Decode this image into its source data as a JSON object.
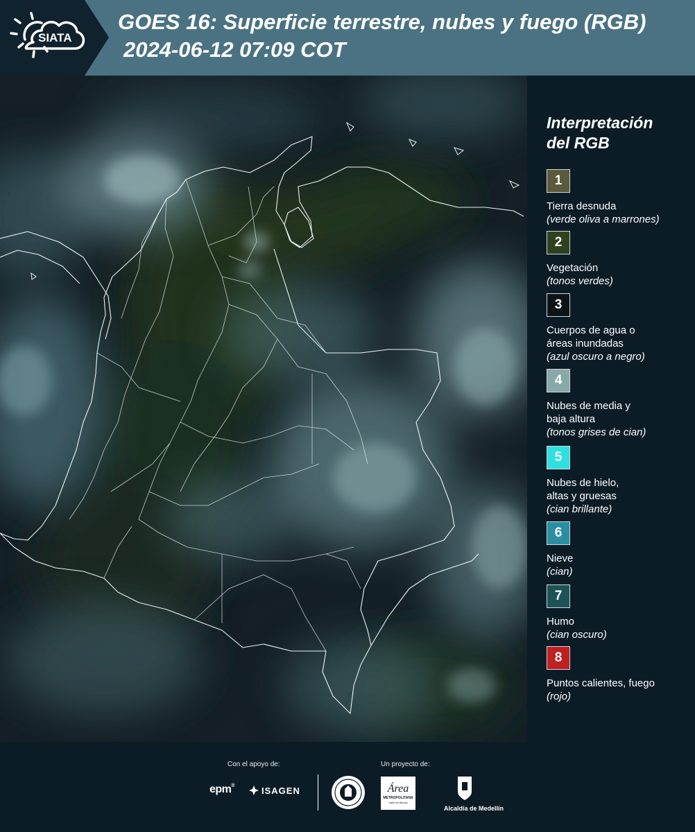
{
  "header": {
    "logo_text": "SIATA",
    "title": "GOES 16: Superficie terrestre, nubes y fuego (RGB)",
    "datetime": "2024-06-12 07:09 COT"
  },
  "legend": {
    "title_line1": "Interpretación",
    "title_line2": "del RGB",
    "items": [
      {
        "num": "1",
        "color": "#5b5a3c",
        "label_lines": [
          "Tierra desnuda"
        ],
        "note": "(verde oliva a marrones)"
      },
      {
        "num": "2",
        "color": "#2f4220",
        "label_lines": [
          "Vegetación"
        ],
        "note": "(tonos verdes)"
      },
      {
        "num": "3",
        "color": "#0d1418",
        "label_lines": [
          "Cuerpos de agua o",
          "áreas inundadas"
        ],
        "note": "(azul oscuro a negro)"
      },
      {
        "num": "4",
        "color": "#88a9a9",
        "label_lines": [
          "Nubes de media y",
          "baja altura"
        ],
        "note": "(tonos grises de cian)"
      },
      {
        "num": "5",
        "color": "#2ee0e0",
        "label_lines": [
          "Nubes de hielo,",
          "altas y gruesas"
        ],
        "note": "(cian brillante)"
      },
      {
        "num": "6",
        "color": "#2b8fa3",
        "label_lines": [
          "Nieve"
        ],
        "note": "(cian)"
      },
      {
        "num": "7",
        "color": "#1c5456",
        "label_lines": [
          "Humo"
        ],
        "note": "(cian oscuro)"
      },
      {
        "num": "8",
        "color": "#c0201f",
        "label_lines": [
          "Puntos calientes, fuego"
        ],
        "note": "(rojo)"
      }
    ]
  },
  "footer": {
    "support_caption": "Con el apoyo de:",
    "project_caption": "Un proyecto de:",
    "sponsor1": "epm",
    "sponsor2": "ISAGEN",
    "partner1_top": "Área",
    "partner1_bottom": "METROPOLITANA",
    "partner1_sub": "Valle de Aburrá",
    "partner2": "Alcaldía de Medellín"
  }
}
